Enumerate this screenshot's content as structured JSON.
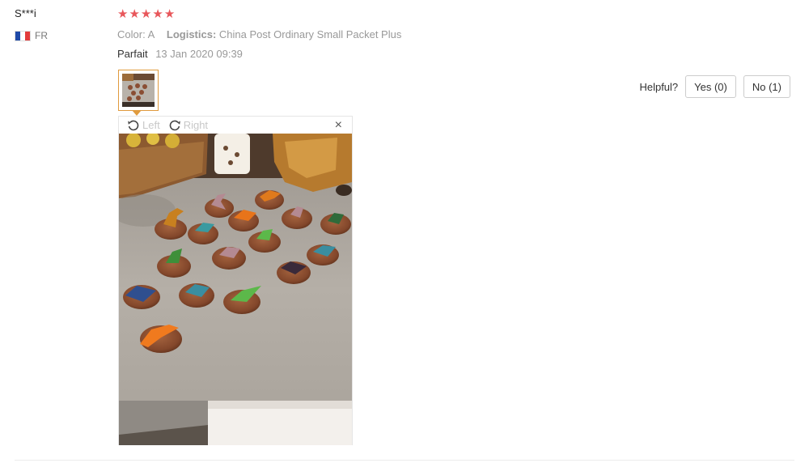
{
  "review": {
    "user_name": "S***i",
    "country": "FR",
    "rating": 5,
    "star_color": "#e8575b",
    "color_label": "Color:",
    "color_value": "A",
    "logistics_label": "Logistics:",
    "logistics_value": "China Post Ordinary Small Packet Plus",
    "text": "Parfait",
    "date": "13 Jan 2020 09:39"
  },
  "helpful": {
    "label": "Helpful?",
    "yes_label": "Yes (0)",
    "no_label": "No (1)"
  },
  "viewer": {
    "rotate_left_label": "Left",
    "rotate_right_label": "Right",
    "close_glyph": "×",
    "accent_color": "#e09b3e"
  },
  "icons": {
    "rotate_left": "rotate-left-icon",
    "rotate_right": "rotate-right-icon",
    "close": "close-icon",
    "star": "star-icon",
    "flag": "flag-france-icon"
  }
}
